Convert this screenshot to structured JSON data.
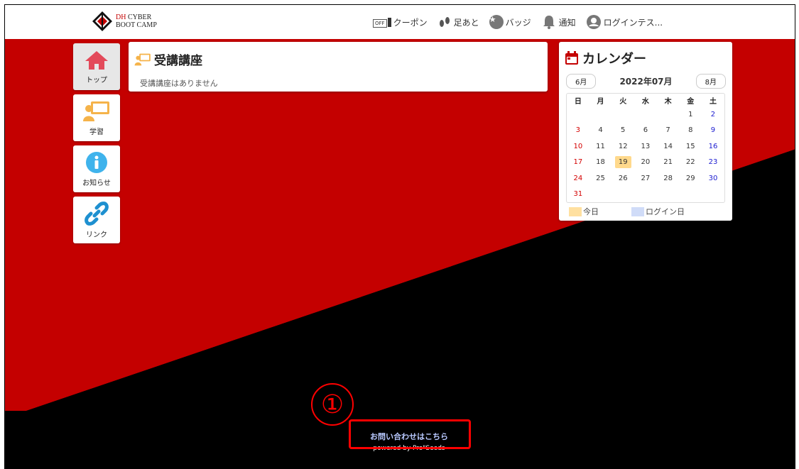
{
  "header": {
    "logo_line1": "CYBER",
    "logo_dh": "DH",
    "logo_line2": "BOOT CAMP",
    "coupon_badge": "OFF",
    "coupon": "クーポン",
    "footprint": "足あと",
    "badge": "バッジ",
    "notice": "通知",
    "login_user": "ログインテス..."
  },
  "sidebar": {
    "items": [
      {
        "label": "トップ",
        "icon": "home-icon"
      },
      {
        "label": "学習",
        "icon": "teacher-board-icon"
      },
      {
        "label": "お知らせ",
        "icon": "info-icon"
      },
      {
        "label": "リンク",
        "icon": "link-icon"
      }
    ]
  },
  "course": {
    "title": "受講講座",
    "empty": "受講講座はありません"
  },
  "calendar": {
    "title": "カレンダー",
    "prev": "6月",
    "month": "2022年07月",
    "next": "8月",
    "weekdays": [
      "日",
      "月",
      "火",
      "水",
      "木",
      "金",
      "土"
    ],
    "weeks": [
      [
        "",
        "",
        "",
        "",
        "",
        "1",
        "2"
      ],
      [
        "3",
        "4",
        "5",
        "6",
        "7",
        "8",
        "9"
      ],
      [
        "10",
        "11",
        "12",
        "13",
        "14",
        "15",
        "16"
      ],
      [
        "17",
        "18",
        "19",
        "20",
        "21",
        "22",
        "23"
      ],
      [
        "24",
        "25",
        "26",
        "27",
        "28",
        "29",
        "30"
      ],
      [
        "31",
        "",
        "",
        "",
        "",
        "",
        ""
      ]
    ],
    "today": "19",
    "legend_today": "今日",
    "legend_login": "ログイン日"
  },
  "footer": {
    "contact": "お問い合わせはこちら",
    "powered": "powered by Pro\"Seeds"
  },
  "annotation": {
    "marker": "①"
  },
  "colors": {
    "accent_red": "#c40000",
    "today_bg": "#ffd98c",
    "login_bg": "#d0dcf8",
    "highlight": "#ff0000"
  }
}
